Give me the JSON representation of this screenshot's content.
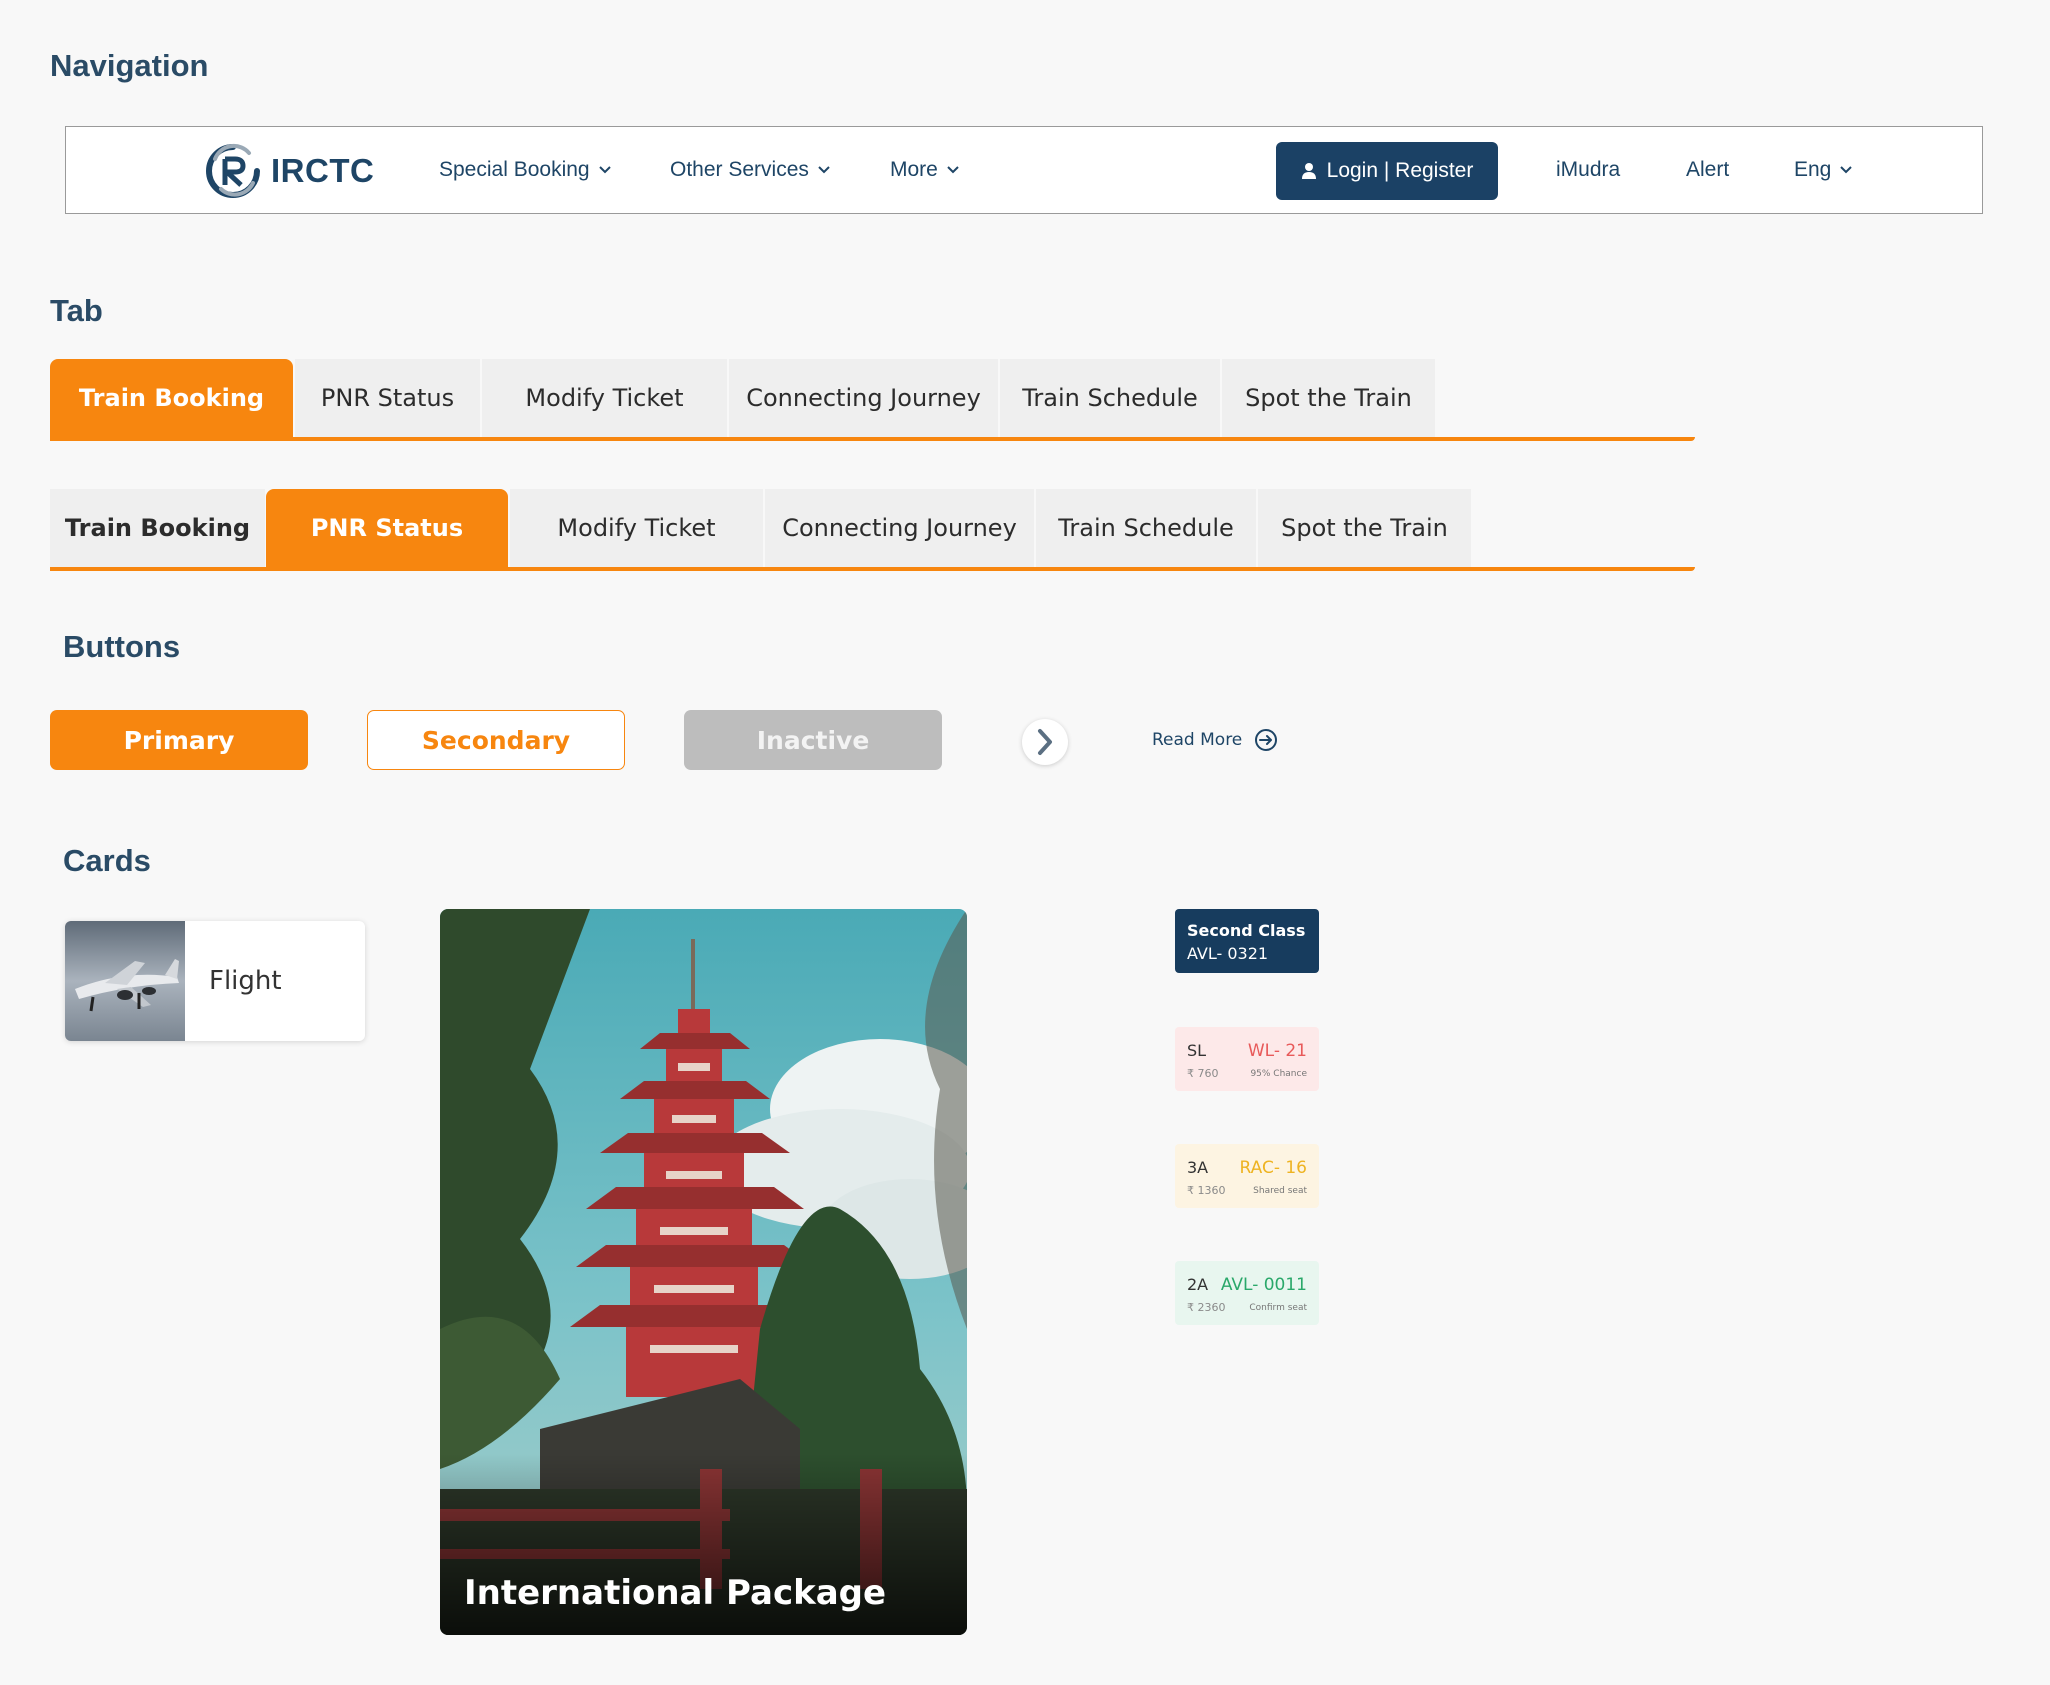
{
  "sections": {
    "navigation": "Navigation",
    "tab": "Tab",
    "buttons": "Buttons",
    "cards": "Cards"
  },
  "nav": {
    "logo_text": "IRCTC",
    "items": [
      "Special Booking",
      "Other Services",
      "More"
    ],
    "login_label": "Login | Register",
    "right_items": [
      "iMudra",
      "Alert",
      "Eng"
    ]
  },
  "tabs": [
    "Train Booking",
    "PNR Status",
    "Modify Ticket",
    "Connecting Journey",
    "Train Schedule",
    "Spot the Train"
  ],
  "buttons": {
    "primary": "Primary",
    "secondary": "Secondary",
    "inactive": "Inactive",
    "read_more": "Read More"
  },
  "cards": {
    "flight": "Flight",
    "package": "International Package",
    "class_chip": {
      "line1": "Second Class",
      "line2": "AVL- 0321"
    },
    "seats": [
      {
        "cls": "SL",
        "price": "₹ 760",
        "status": "WL- 21",
        "sub": "95% Chance",
        "color": "#e85a5a"
      },
      {
        "cls": "3A",
        "price": "₹ 1360",
        "status": "RAC- 16",
        "sub": "Shared seat",
        "color": "#eeb321"
      },
      {
        "cls": "2A",
        "price": "₹ 2360",
        "status": "AVL- 0011",
        "sub": "Confirm seat",
        "color": "#2aa86a"
      }
    ]
  },
  "colors": {
    "accent": "#f7860f",
    "navy": "#1b4165",
    "inactive": "#bdbdbd"
  }
}
